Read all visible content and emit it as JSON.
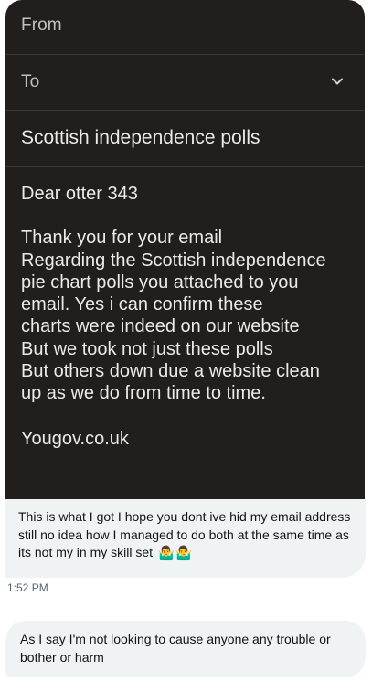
{
  "email": {
    "from_label": "From",
    "to_label": "To",
    "subject": "Scottish independence polls",
    "greeting": "Dear otter 343",
    "body_lines": [
      "Thank you for your email",
      "Regarding the Scottish independence",
      "pie chart polls you attached to you",
      "email. Yes i can confirm these",
      "charts  were indeed on our website",
      "But we took  not just these polls",
      "But others down due a website clean",
      "up as we do from time to time."
    ],
    "signature": "Yougov.co.uk",
    "to_dropdown_icon": "chevron-down-icon"
  },
  "messages": [
    {
      "text": "This is what I got I hope you dont ive hid my email address still no idea how I managed to do both at the same time as its not my in my skill set",
      "emoji": "🤷‍♂️🤷‍♂️",
      "timestamp": "1:52 PM"
    },
    {
      "text": "As I say I'm not looking to cause anyone any trouble or bother or harm"
    }
  ],
  "colors": {
    "email_background": "#211e1d",
    "bubble_background": "#eff3f4",
    "timestamp_color": "#536471"
  }
}
